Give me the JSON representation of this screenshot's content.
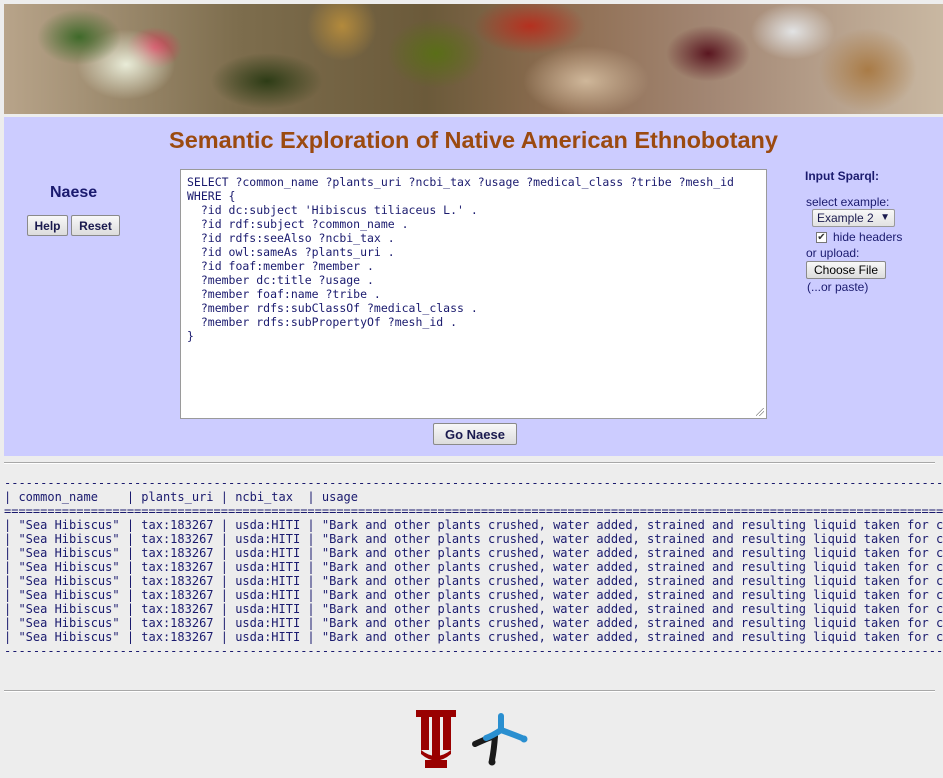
{
  "header": {
    "title": "Semantic Exploration of Native American Ethnobotany"
  },
  "left": {
    "label": "Naese",
    "help_label": "Help",
    "reset_label": "Reset"
  },
  "query": {
    "text": "SELECT ?common_name ?plants_uri ?ncbi_tax ?usage ?medical_class ?tribe ?mesh_id\nWHERE {\n  ?id dc:subject 'Hibiscus tiliaceus L.' .\n  ?id rdf:subject ?common_name .\n  ?id rdfs:seeAlso ?ncbi_tax .\n  ?id owl:sameAs ?plants_uri .\n  ?id foaf:member ?member .\n  ?member dc:title ?usage .\n  ?member foaf:name ?tribe .\n  ?member rdfs:subClassOf ?medical_class .\n  ?member rdfs:subPropertyOf ?mesh_id .\n}",
    "go_label": "Go Naese"
  },
  "right": {
    "input_label": "Input Sparql:",
    "select_label": "select example:",
    "selected_example": "Example 2",
    "hide_headers_label": "hide headers",
    "hide_headers_checked": true,
    "upload_label": "or upload:",
    "choose_file_label": "Choose File",
    "paste_label": "(...or paste)"
  },
  "results": {
    "dash_line": "-------------------------------------------------------------------------------------------------------------------------------------------------------------",
    "header_line": "| common_name    | plants_uri | ncbi_tax  | usage",
    "equals_line": "=============================================================================================================================================================",
    "rows": [
      "| \"Sea Hibiscus\" | tax:183267 | usda:HITI | \"Bark and other plants crushed, water added, strained and resulting liquid taken for congestion.\"",
      "| \"Sea Hibiscus\" | tax:183267 | usda:HITI | \"Bark and other plants crushed, water added, strained and resulting liquid taken for congestion.\"",
      "| \"Sea Hibiscus\" | tax:183267 | usda:HITI | \"Bark and other plants crushed, water added, strained and resulting liquid taken for congestion.\"",
      "| \"Sea Hibiscus\" | tax:183267 | usda:HITI | \"Bark and other plants crushed, water added, strained and resulting liquid taken for congestion.\"",
      "| \"Sea Hibiscus\" | tax:183267 | usda:HITI | \"Bark and other plants crushed, water added, strained and resulting liquid taken for congestion.\"",
      "| \"Sea Hibiscus\" | tax:183267 | usda:HITI | \"Bark and other plants crushed, water added, strained and resulting liquid taken for congestion.\"",
      "| \"Sea Hibiscus\" | tax:183267 | usda:HITI | \"Bark and other plants crushed, water added, strained and resulting liquid taken for congestion.\"",
      "| \"Sea Hibiscus\" | tax:183267 | usda:HITI | \"Bark and other plants crushed, water added, strained and resulting liquid taken for congestion.\"",
      "| \"Sea Hibiscus\" | tax:183267 | usda:HITI | \"Bark and other plants crushed, water added, strained and resulting liquid taken for congestion.\""
    ]
  },
  "colors": {
    "panel_bg": "#ccccff",
    "title": "#9b4a10",
    "text": "#1a1a6e",
    "iu_crimson": "#990000",
    "logo_dark": "#1a1a1a",
    "logo_blue": "#2a8fd0"
  },
  "icons": {
    "banner": "botanical-collage-banner",
    "logo_left": "indiana-university-trident-logo",
    "logo_right": "network-node-logo"
  }
}
